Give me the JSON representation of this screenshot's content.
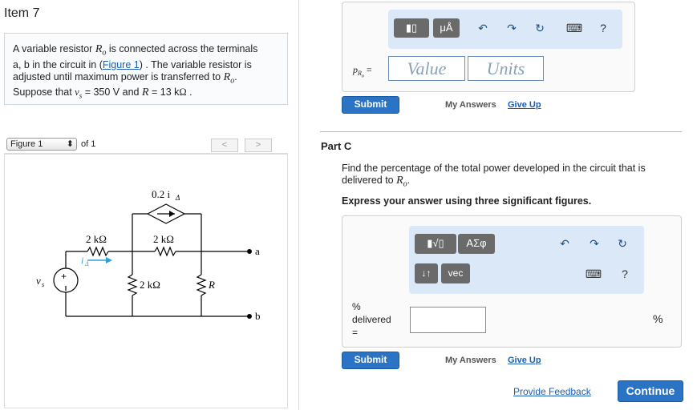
{
  "item": {
    "title": "Item 7"
  },
  "problem": {
    "text_a": "A variable resistor",
    "rvar": "R",
    "rsub": "o",
    "text_b": " is connected across the terminals",
    "text_c": "a, b in the circuit in (",
    "figure_link": "Figure 1",
    "text_d": ") . The variable resistor is",
    "text_e": "adjusted until maximum power is transferred to",
    "text_f": "Suppose that",
    "vs_val": " = 350  V and ",
    "r_val": " = 13  k",
    "omega": "Ω",
    "period": " ."
  },
  "figure_nav": {
    "select": "Figure 1",
    "of": "of 1",
    "prev": "<",
    "next": ">"
  },
  "circuit": {
    "dep_source": "0.2 i",
    "dep_sub": "Δ",
    "r_left": "2 kΩ",
    "r_top": "2 kΩ",
    "r_mid": "2 kΩ",
    "r_var": "R",
    "current": "i",
    "current_sub": "Δ",
    "vs": "v",
    "vs_sub": "s",
    "node_a": "a",
    "node_b": "b",
    "plus": "+",
    "minus": "−"
  },
  "partb": {
    "label": "p",
    "label_sub": "R",
    "label_subsub": "o",
    "eq": "=",
    "value_placeholder": "Value",
    "units_placeholder": "Units",
    "toolbar": {
      "templates": "▮▯",
      "units": "μÅ",
      "undo": "↶",
      "redo": "↷",
      "reset": "↻",
      "keyboard": "⌨",
      "help": "?"
    },
    "submit": "Submit",
    "my_answers": "My Answers",
    "give_up": "Give Up"
  },
  "partc": {
    "title": "Part C",
    "question": "Find the percentage of the total power developed in the circuit that is delivered to ",
    "q_r": "R",
    "q_sub": "o",
    "q_end": ".",
    "instruction": "Express your answer using three significant figures.",
    "toolbar": {
      "sqrt": "▮√▯",
      "greek": "ΑΣφ",
      "arrows": "↓↑",
      "vec": "vec",
      "undo": "↶",
      "redo": "↷",
      "reset": "↻",
      "keyboard": "⌨",
      "help": "?"
    },
    "label_pct": "%",
    "label_delivered": "delivered",
    "label_eq": "=",
    "unit": "%",
    "submit": "Submit",
    "my_answers": "My Answers",
    "give_up": "Give Up"
  },
  "footer": {
    "feedback": "Provide Feedback",
    "continue": "Continue"
  }
}
